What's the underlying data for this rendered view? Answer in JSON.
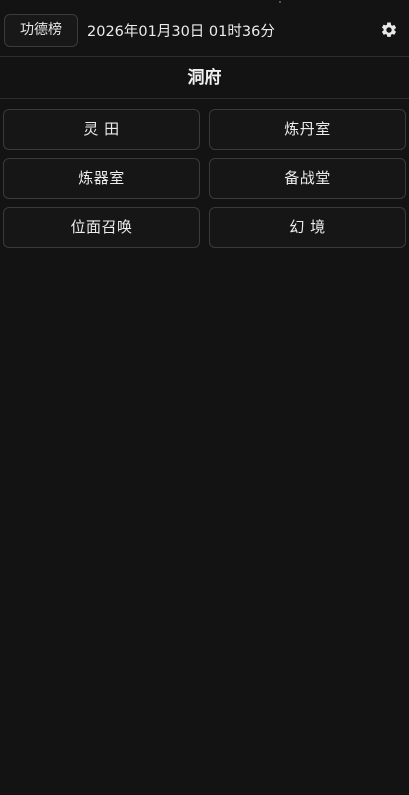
{
  "header": {
    "rank_label": "功德榜",
    "datetime": "2026年01月30日 01时36分",
    "settings_icon": "gear-icon"
  },
  "page_title": "洞府",
  "tiles": [
    {
      "label": "灵 田"
    },
    {
      "label": "炼丹室"
    },
    {
      "label": "炼器室"
    },
    {
      "label": "备战堂"
    },
    {
      "label": "位面召唤"
    },
    {
      "label": "幻 境"
    }
  ],
  "colors": {
    "background": "#131313",
    "tile_border": "#3a3a3a",
    "text": "#ececec"
  }
}
